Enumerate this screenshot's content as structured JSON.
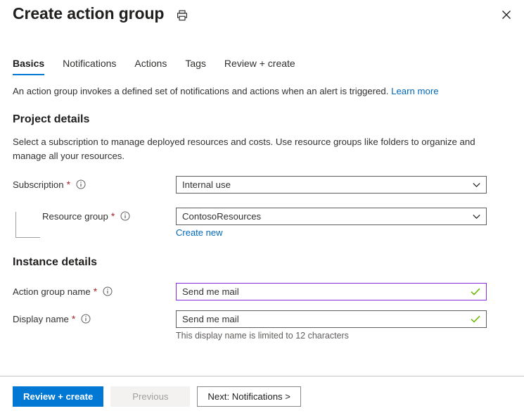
{
  "header": {
    "title": "Create action group",
    "print_icon": "printer-icon",
    "close_icon": "close-icon"
  },
  "tabs": [
    {
      "label": "Basics",
      "active": true
    },
    {
      "label": "Notifications",
      "active": false
    },
    {
      "label": "Actions",
      "active": false
    },
    {
      "label": "Tags",
      "active": false
    },
    {
      "label": "Review + create",
      "active": false
    }
  ],
  "intro": {
    "text": "An action group invokes a defined set of notifications and actions when an alert is triggered.",
    "link_label": "Learn more"
  },
  "project_details": {
    "heading": "Project details",
    "description": "Select a subscription to manage deployed resources and costs. Use resource groups like folders to organize and manage all your resources.",
    "subscription": {
      "label": "Subscription",
      "required_marker": "*",
      "info_icon": "info-icon",
      "value": "Internal use",
      "chevron_icon": "chevron-down-icon"
    },
    "resource_group": {
      "label": "Resource group",
      "required_marker": "*",
      "info_icon": "info-icon",
      "value": "ContosoResources",
      "chevron_icon": "chevron-down-icon",
      "create_new_label": "Create new"
    }
  },
  "instance_details": {
    "heading": "Instance details",
    "action_group_name": {
      "label": "Action group name",
      "required_marker": "*",
      "info_icon": "info-icon",
      "value": "Send me mail",
      "placeholder": "",
      "validation_icon": "checkmark-icon",
      "border_color": "#8a2be2"
    },
    "display_name": {
      "label": "Display name",
      "required_marker": "*",
      "info_icon": "info-icon",
      "value": "Send me mail",
      "placeholder": "",
      "validation_icon": "checkmark-icon",
      "help_text": "This display name is limited to 12 characters"
    }
  },
  "footer": {
    "review_create_label": "Review + create",
    "previous_label": "Previous",
    "next_label": "Next: Notifications >"
  },
  "colors": {
    "accent": "#0078d4",
    "link": "#0067b8",
    "required": "#a4262c",
    "validation": "#6bb700",
    "focus_border": "#8a2be2"
  }
}
